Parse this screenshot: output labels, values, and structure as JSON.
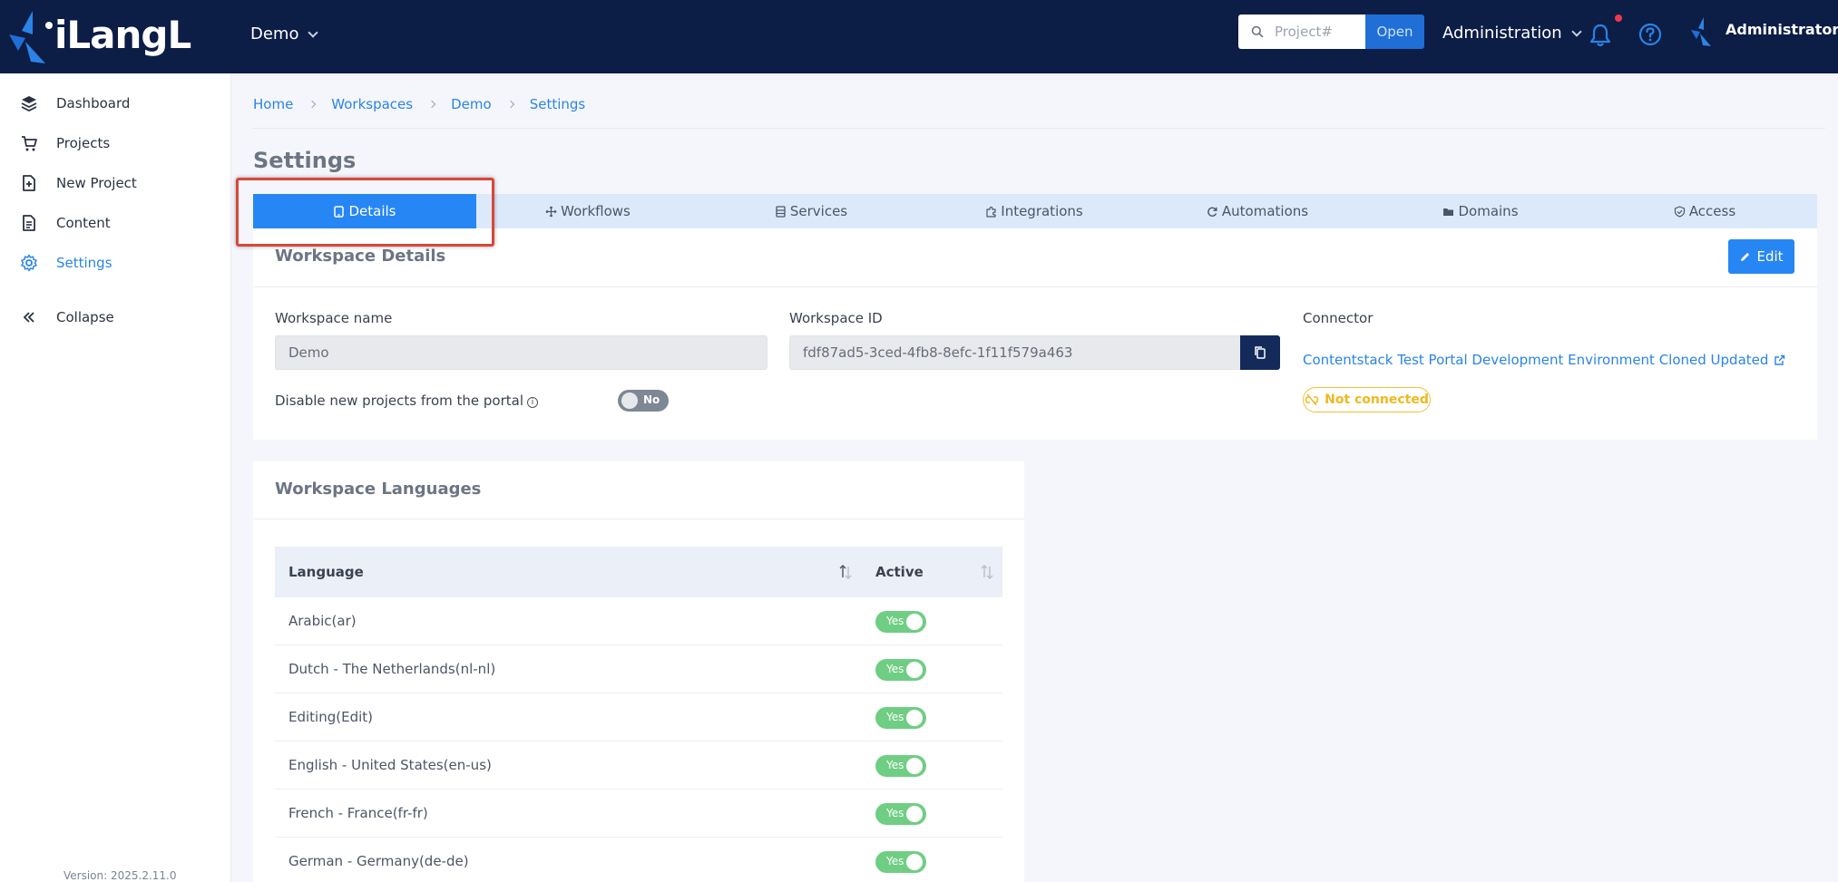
{
  "header": {
    "logo_text": "iLangL",
    "workspace": "Demo",
    "search_placeholder": "Project#",
    "open_label": "Open",
    "admin_menu": "Administration",
    "user_name": "Administrator"
  },
  "sidebar": {
    "items": [
      {
        "label": "Dashboard",
        "icon": "layers-icon"
      },
      {
        "label": "Projects",
        "icon": "cart-icon"
      },
      {
        "label": "New Project",
        "icon": "file-plus-icon"
      },
      {
        "label": "Content",
        "icon": "document-icon"
      },
      {
        "label": "Settings",
        "icon": "gear-icon",
        "active": true
      },
      {
        "label": "Collapse",
        "icon": "double-chevron-left-icon"
      }
    ],
    "version": "Version: 2025.2.11.0"
  },
  "breadcrumb": [
    "Home",
    "Workspaces",
    "Demo",
    "Settings"
  ],
  "page_title": "Settings",
  "tabs": [
    {
      "label": "Details",
      "icon": "tablet-icon",
      "active": true
    },
    {
      "label": "Workflows",
      "icon": "move-icon"
    },
    {
      "label": "Services",
      "icon": "server-icon"
    },
    {
      "label": "Integrations",
      "icon": "puzzle-icon"
    },
    {
      "label": "Automations",
      "icon": "refresh-icon"
    },
    {
      "label": "Domains",
      "icon": "folder-icon"
    },
    {
      "label": "Access",
      "icon": "shield-check-icon"
    }
  ],
  "details": {
    "title": "Workspace Details",
    "edit_label": "Edit",
    "workspace_name_label": "Workspace name",
    "workspace_name_value": "Demo",
    "workspace_id_label": "Workspace ID",
    "workspace_id_value": "fdf87ad5-3ced-4fb8-8efc-1f11f579a463",
    "connector_label": "Connector",
    "connector_link": "Contentstack Test Portal Development Environment Cloned Updated",
    "connector_status": "Not connected",
    "disable_label": "Disable new projects from the portal",
    "disable_value": "No"
  },
  "languages": {
    "title": "Workspace Languages",
    "col_language": "Language",
    "col_active": "Active",
    "rows": [
      {
        "name": "Arabic(ar)",
        "active": "Yes"
      },
      {
        "name": "Dutch - The Netherlands(nl-nl)",
        "active": "Yes"
      },
      {
        "name": "Editing(Edit)",
        "active": "Yes"
      },
      {
        "name": "English - United States(en-us)",
        "active": "Yes"
      },
      {
        "name": "French - France(fr-fr)",
        "active": "Yes"
      },
      {
        "name": "German - Germany(de-de)",
        "active": "Yes"
      }
    ]
  },
  "colors": {
    "topbar": "#0c1d46",
    "accent": "#2686f4",
    "tab_bar": "#dce9fb",
    "toggle_on": "#6fce84",
    "warning": "#f0b820",
    "highlight": "#d8473a"
  }
}
